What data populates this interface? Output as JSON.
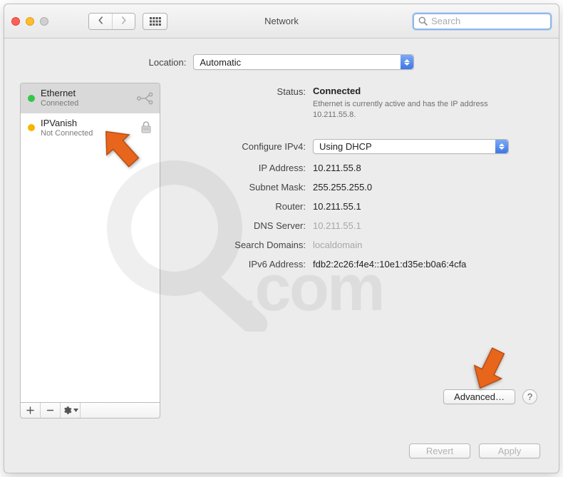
{
  "window": {
    "title": "Network"
  },
  "search": {
    "placeholder": "Search",
    "value": ""
  },
  "location": {
    "label": "Location:",
    "selected": "Automatic"
  },
  "services": [
    {
      "name": "Ethernet",
      "status": "Connected",
      "dot": "green",
      "selected": true
    },
    {
      "name": "IPVanish",
      "status": "Not Connected",
      "dot": "yellow",
      "selected": false
    }
  ],
  "status": {
    "label": "Status:",
    "state": "Connected",
    "description": "Ethernet is currently active and has the IP address 10.211.55.8."
  },
  "configure": {
    "label": "Configure IPv4:",
    "selected": "Using DHCP"
  },
  "fields": {
    "ip_label": "IP Address:",
    "ip_value": "10.211.55.8",
    "mask_label": "Subnet Mask:",
    "mask_value": "255.255.255.0",
    "router_label": "Router:",
    "router_value": "10.211.55.1",
    "dns_label": "DNS Server:",
    "dns_value": "10.211.55.1",
    "search_label": "Search Domains:",
    "search_value": "localdomain",
    "ipv6_label": "IPv6 Address:",
    "ipv6_value": "fdb2:2c26:f4e4::10e1:d35e:b0a6:4cfa"
  },
  "buttons": {
    "advanced": "Advanced…",
    "revert": "Revert",
    "apply": "Apply",
    "help": "?"
  }
}
